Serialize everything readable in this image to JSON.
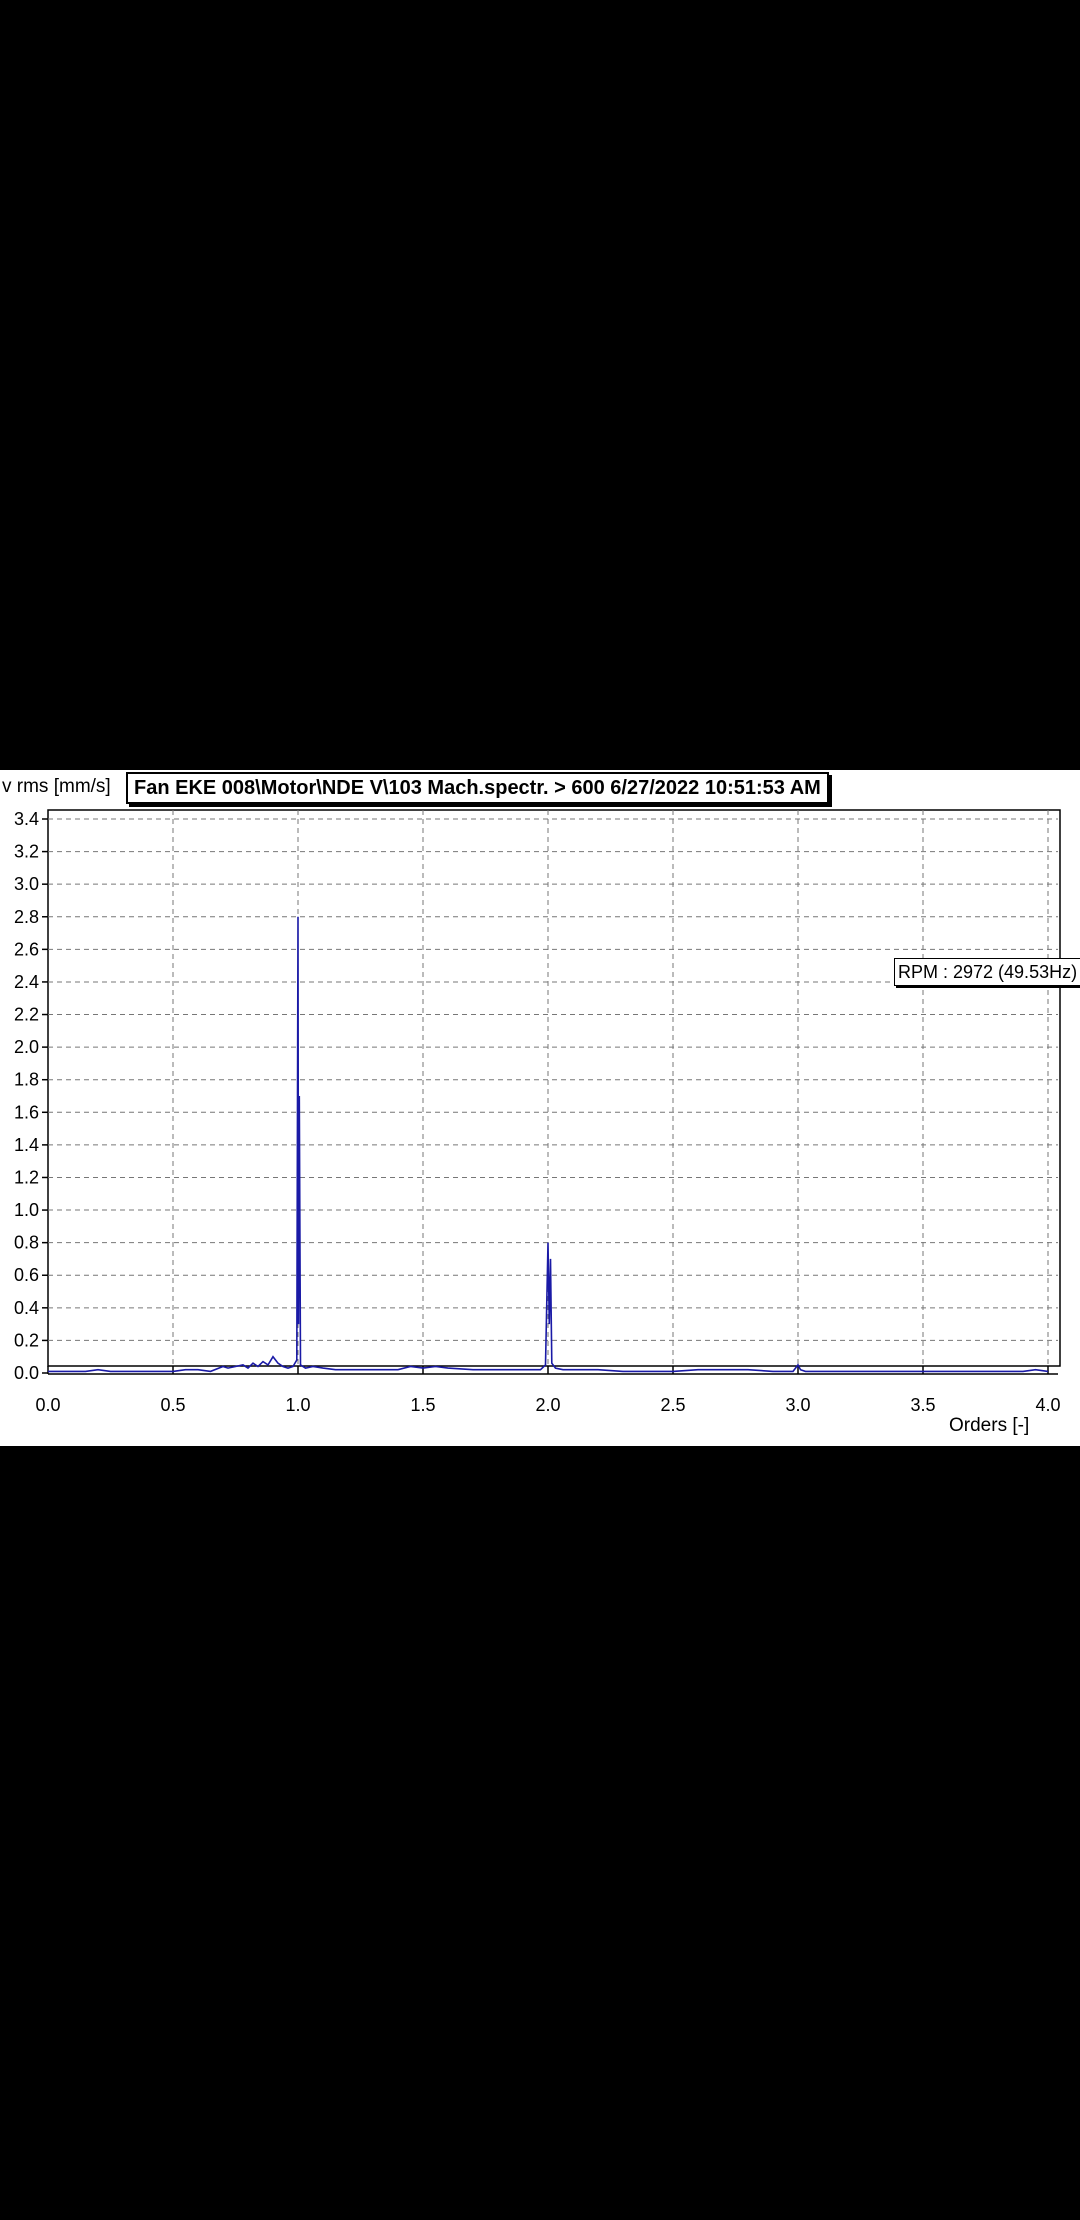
{
  "chart_data": {
    "type": "line",
    "title": "Fan EKE 008\\Motor\\NDE V\\103 Mach.spectr. > 600 6/27/2022 10:51:53 AM",
    "ylabel": "v rms [mm/s]",
    "xlabel": "Orders [-]",
    "annotation": "RPM : 2972 (49.53Hz)",
    "xlim": [
      0,
      4.0
    ],
    "ylim": [
      0,
      3.45
    ],
    "grid": true,
    "x_ticks": [
      {
        "value": 0,
        "label": "0.0"
      },
      {
        "value": 0.5,
        "label": "0.5"
      },
      {
        "value": 1.0,
        "label": "1.0"
      },
      {
        "value": 1.5,
        "label": "1.5"
      },
      {
        "value": 2.0,
        "label": "2.0"
      },
      {
        "value": 2.5,
        "label": "2.5"
      },
      {
        "value": 3.0,
        "label": "3.0"
      },
      {
        "value": 3.5,
        "label": "3.5"
      },
      {
        "value": 4.0,
        "label": "4.0"
      }
    ],
    "y_ticks": [
      {
        "value": 0,
        "label": "0.0"
      },
      {
        "value": 0.2,
        "label": "0.2"
      },
      {
        "value": 0.4,
        "label": "0.4"
      },
      {
        "value": 0.6,
        "label": "0.6"
      },
      {
        "value": 0.8,
        "label": "0.8"
      },
      {
        "value": 1.0,
        "label": "1.0"
      },
      {
        "value": 1.2,
        "label": "1.2"
      },
      {
        "value": 1.4,
        "label": "1.4"
      },
      {
        "value": 1.6,
        "label": "1.6"
      },
      {
        "value": 1.8,
        "label": "1.8"
      },
      {
        "value": 2.0,
        "label": "2.0"
      },
      {
        "value": 2.2,
        "label": "2.2"
      },
      {
        "value": 2.4,
        "label": "2.4"
      },
      {
        "value": 2.6,
        "label": "2.6"
      },
      {
        "value": 2.8,
        "label": "2.8"
      },
      {
        "value": 3.0,
        "label": "3.0"
      },
      {
        "value": 3.2,
        "label": "3.2"
      },
      {
        "value": 3.4,
        "label": "3.4"
      }
    ],
    "series": [
      {
        "color": "#1a1aa6",
        "x": [
          0.0,
          0.15,
          0.2,
          0.25,
          0.3,
          0.5,
          0.55,
          0.6,
          0.65,
          0.7,
          0.72,
          0.75,
          0.78,
          0.8,
          0.82,
          0.84,
          0.86,
          0.88,
          0.9,
          0.92,
          0.94,
          0.96,
          0.98,
          0.995,
          1.0,
          1.002,
          1.005,
          1.01,
          1.03,
          1.06,
          1.1,
          1.15,
          1.2,
          1.3,
          1.4,
          1.45,
          1.5,
          1.55,
          1.6,
          1.7,
          1.8,
          1.9,
          1.97,
          1.99,
          2.0,
          2.005,
          2.01,
          2.015,
          2.03,
          2.06,
          2.1,
          2.2,
          2.3,
          2.4,
          2.5,
          2.6,
          2.7,
          2.8,
          2.9,
          2.98,
          3.0,
          3.01,
          3.03,
          3.1,
          3.3,
          3.5,
          3.7,
          3.9,
          3.95,
          4.0
        ],
        "y": [
          0.01,
          0.01,
          0.02,
          0.01,
          0.01,
          0.01,
          0.02,
          0.02,
          0.01,
          0.04,
          0.03,
          0.04,
          0.05,
          0.03,
          0.06,
          0.04,
          0.07,
          0.05,
          0.1,
          0.06,
          0.04,
          0.03,
          0.04,
          0.08,
          2.8,
          0.3,
          1.7,
          0.05,
          0.03,
          0.04,
          0.03,
          0.02,
          0.02,
          0.02,
          0.02,
          0.04,
          0.03,
          0.04,
          0.03,
          0.02,
          0.02,
          0.02,
          0.02,
          0.05,
          0.8,
          0.3,
          0.7,
          0.06,
          0.03,
          0.02,
          0.02,
          0.02,
          0.01,
          0.01,
          0.01,
          0.02,
          0.02,
          0.02,
          0.01,
          0.01,
          0.05,
          0.02,
          0.01,
          0.01,
          0.01,
          0.01,
          0.01,
          0.01,
          0.02,
          0.01
        ]
      }
    ]
  }
}
